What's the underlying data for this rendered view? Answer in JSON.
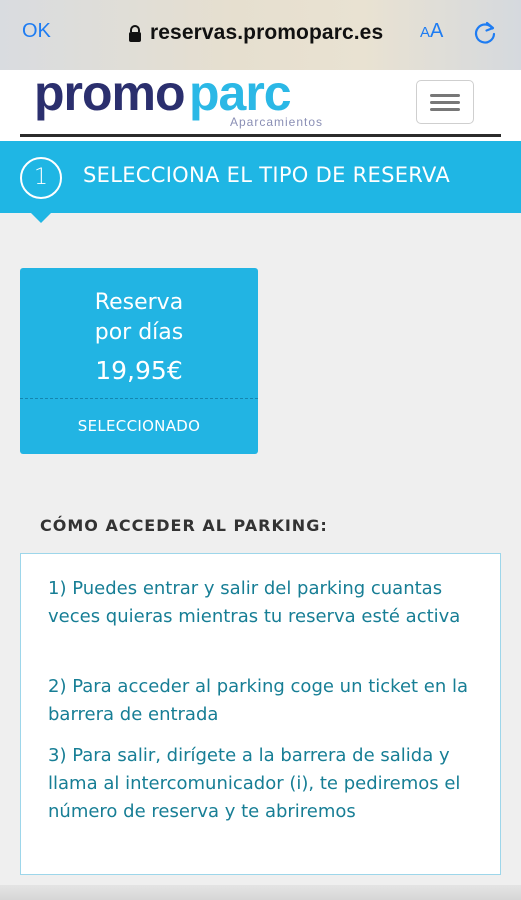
{
  "browser": {
    "done_label": "OK",
    "url": "reservas.promoparc.es",
    "text_size_small": "A",
    "text_size_big": "A",
    "lock_icon": "lock-icon",
    "reload_icon": "reload-icon"
  },
  "site": {
    "logo_primary": "promo",
    "logo_secondary": "parc",
    "logo_tagline": "Aparcamientos",
    "menu_icon": "hamburger-icon"
  },
  "step": {
    "number": "1",
    "title": "SELECCIONA EL TIPO DE RESERVA"
  },
  "reservation": {
    "title_line1": "Reserva",
    "title_line2": "por días",
    "price": "19,95€",
    "status": "SELECCIONADO"
  },
  "access": {
    "heading": "CÓMO ACCEDER AL PARKING:",
    "items": [
      "1) Puedes entrar y salir del parking cuantas veces quieras mientras tu reserva esté activa",
      "2) Para acceder al parking coge un ticket en la barrera de entrada",
      "3) Para salir, dirígete a la barrera de salida y llama al intercomunicador (i), te pediremos el número de reserva y te abriremos"
    ]
  },
  "colors": {
    "accent": "#1fb6e4",
    "logo_dark": "#2b2f6e",
    "logo_light": "#2bb8e6",
    "info_text": "#177e95",
    "ios_blue": "#1e7cf2"
  }
}
